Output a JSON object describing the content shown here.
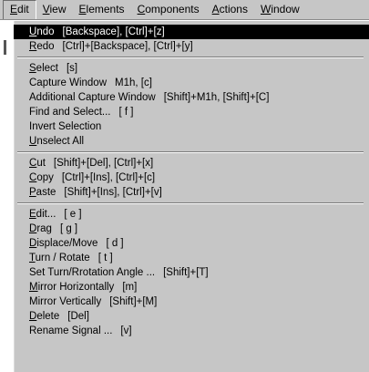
{
  "menubar": {
    "items": [
      {
        "label": "Edit",
        "mnemonic": "E",
        "rest": "dit",
        "active": true
      },
      {
        "label": "View",
        "mnemonic": "V",
        "rest": "iew"
      },
      {
        "label": "Elements",
        "mnemonic": "E",
        "rest": "lements"
      },
      {
        "label": "Components",
        "mnemonic": "C",
        "rest": "omponents"
      },
      {
        "label": "Actions",
        "mnemonic": "A",
        "rest": "ctions"
      },
      {
        "label": "Window",
        "mnemonic": "W",
        "rest": "indow"
      }
    ]
  },
  "edit_menu": {
    "groups": [
      [
        {
          "label": "Undo",
          "shortcut": "[Backspace], [Ctrl]+[z]",
          "selected": true
        },
        {
          "label": "Redo",
          "shortcut": "[Ctrl]+[Backspace], [Ctrl]+[y]"
        }
      ],
      [
        {
          "label": "Select",
          "shortcut": "[s]"
        },
        {
          "label": "Capture Window",
          "shortcut": "M1h, [c]"
        },
        {
          "label": "Additional Capture Window",
          "shortcut": "[Shift]+M1h, [Shift]+[C]"
        },
        {
          "label": "Find and Select...",
          "shortcut": "[ f ]"
        },
        {
          "label": "Invert Selection",
          "shortcut": ""
        },
        {
          "label": "Unselect All",
          "shortcut": ""
        }
      ],
      [
        {
          "label": "Cut",
          "shortcut": "[Shift]+[Del], [Ctrl]+[x]"
        },
        {
          "label": "Copy",
          "shortcut": "[Ctrl]+[Ins], [Ctrl]+[c]"
        },
        {
          "label": "Paste",
          "shortcut": "[Shift]+[Ins], [Ctrl]+[v]"
        }
      ],
      [
        {
          "label": "Edit...",
          "shortcut": "[ e ]"
        },
        {
          "label": "Drag",
          "shortcut": "[ g ]"
        },
        {
          "label": "Displace/Move",
          "shortcut": "[ d ]"
        },
        {
          "label": "Turn / Rotate",
          "shortcut": "[ t ]"
        },
        {
          "label": "Set Turn/Rrotation Angle ...",
          "shortcut": "[Shift]+[T]"
        },
        {
          "label": "Mirror Horizontally",
          "shortcut": "[m]"
        },
        {
          "label": "Mirror Vertically",
          "shortcut": "[Shift]+[M]"
        },
        {
          "label": "Delete",
          "shortcut": "[Del]"
        },
        {
          "label": "Rename Signal ...",
          "shortcut": "[v]"
        }
      ]
    ]
  }
}
